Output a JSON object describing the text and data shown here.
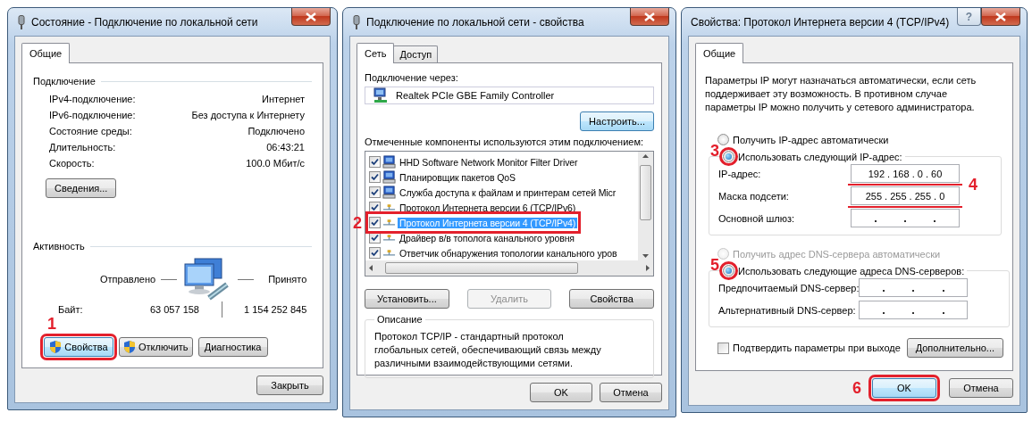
{
  "status_dialog": {
    "title": "Состояние - Подключение по локальной сети",
    "tabs": [
      {
        "label": "Общие",
        "selected": true
      }
    ],
    "connection": {
      "heading": "Подключение",
      "rows": [
        {
          "label": "IPv4-подключение:",
          "value": "Интернет"
        },
        {
          "label": "IPv6-подключение:",
          "value": "Без доступа к Интернету"
        },
        {
          "label": "Состояние среды:",
          "value": "Подключено"
        },
        {
          "label": "Длительность:",
          "value": "06:43:21"
        },
        {
          "label": "Скорость:",
          "value": "100.0 Мбит/с"
        }
      ]
    },
    "details_button": "Сведения...",
    "activity": {
      "heading": "Активность",
      "sent_label": "Отправлено",
      "received_label": "Принято",
      "bytes_label": "Байт:",
      "bytes_sent": "63 057 158",
      "bytes_received": "1 154 252 845"
    },
    "actions": [
      {
        "label": "Свойства",
        "shield": true,
        "focused": true,
        "highlighted": true,
        "step": "1"
      },
      {
        "label": "Отключить",
        "shield": true,
        "focused": false,
        "highlighted": false
      },
      {
        "label": "Диагностика",
        "shield": false,
        "focused": false,
        "highlighted": false
      }
    ],
    "close_button": "Закрыть"
  },
  "properties_dialog": {
    "title": "Подключение по локальной сети - свойства",
    "tabs": [
      {
        "label": "Сеть",
        "selected": true
      },
      {
        "label": "Доступ",
        "selected": false
      }
    ],
    "connect_via_label": "Подключение через:",
    "adapter": "Realtek PCIe GBE Family Controller",
    "configure_button": {
      "label": "Настроить...",
      "focused": true
    },
    "components_label": "Отмеченные компоненты используются этим подключением:",
    "components": [
      {
        "label": "HHD Software Network Monitor Filter Driver",
        "kind": "service",
        "checked": true,
        "selected": false,
        "highlighted": false
      },
      {
        "label": "Планировщик пакетов QoS",
        "kind": "service",
        "checked": true,
        "selected": false,
        "highlighted": false
      },
      {
        "label": "Служба доступа к файлам и принтерам сетей Micr",
        "kind": "service",
        "checked": true,
        "selected": false,
        "highlighted": false
      },
      {
        "label": "Протокол Интернета версии 6 (TCP/IPv6)",
        "kind": "protocol",
        "checked": true,
        "selected": false,
        "highlighted": false
      },
      {
        "label": "Протокол Интернета версии 4 (TCP/IPv4)",
        "kind": "protocol",
        "checked": true,
        "selected": true,
        "highlighted": true,
        "step": "2"
      },
      {
        "label": "Драйвер в/в тополога канального уровня",
        "kind": "protocol",
        "checked": true,
        "selected": false,
        "highlighted": false
      },
      {
        "label": "Ответчик обнаружения топологии канального уров",
        "kind": "protocol",
        "checked": true,
        "selected": false,
        "highlighted": false
      }
    ],
    "actions": [
      {
        "label": "Установить...",
        "disabled": false
      },
      {
        "label": "Удалить",
        "disabled": true
      },
      {
        "label": "Свойства",
        "disabled": false
      }
    ],
    "description": {
      "heading": "Описание",
      "text": "Протокол TCP/IP - стандартный протокол глобальных сетей, обеспечивающий связь между различными взаимодействующими сетями."
    },
    "footer_buttons": [
      "OK",
      "Отмена"
    ]
  },
  "ipv4_dialog": {
    "title": "Свойства: Протокол Интернета версии 4 (TCP/IPv4)",
    "help_button": "?",
    "tabs": [
      {
        "label": "Общие",
        "selected": true
      }
    ],
    "intro": "Параметры IP могут назначаться автоматически, если сеть поддерживает эту возможность. В противном случае параметры IP можно получить у сетевого администратора.",
    "ip_modes": [
      {
        "label": "Получить IP-адрес автоматически",
        "selected": false,
        "disabled": false,
        "highlighted": false
      },
      {
        "label": "Использовать следующий IP-адрес:",
        "selected": true,
        "disabled": false,
        "highlighted": true,
        "step": "3"
      }
    ],
    "ip_fields_step": "4",
    "ip_fields": [
      {
        "label": "IP-адрес:",
        "value": "192 . 168 . 0 . 60",
        "underlined": true
      },
      {
        "label": "Маска подсети:",
        "value": "255 . 255 . 255 . 0",
        "underlined": true
      },
      {
        "label": "Основной шлюз:",
        "underlined": false
      }
    ],
    "dns_modes": [
      {
        "label": "Получить адрес DNS-сервера автоматически",
        "selected": false,
        "disabled": true,
        "highlighted": false
      },
      {
        "label": "Использовать следующие адреса DNS-серверов:",
        "selected": true,
        "disabled": false,
        "highlighted": true,
        "step": "5"
      }
    ],
    "dns_fields": [
      {
        "label": "Предпочитаемый DNS-сервер:"
      },
      {
        "label": "Альтернативный DNS-сервер:"
      }
    ],
    "validate": {
      "label": "Подтвердить параметры при выходе",
      "checked": false
    },
    "advanced_button": "Дополнительно...",
    "footer_buttons": [
      {
        "label": "OK",
        "focused": true,
        "highlighted": true,
        "step": "6"
      },
      {
        "label": "Отмена",
        "focused": false,
        "highlighted": false
      }
    ]
  }
}
